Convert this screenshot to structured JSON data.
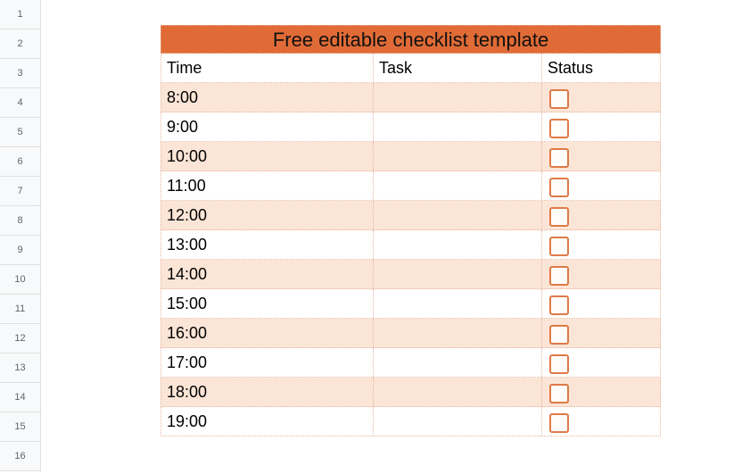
{
  "rowHeaders": [
    "1",
    "2",
    "3",
    "4",
    "5",
    "6",
    "7",
    "8",
    "9",
    "10",
    "11",
    "12",
    "13",
    "14",
    "15",
    "16"
  ],
  "title": "Free editable checklist template",
  "columns": {
    "time": "Time",
    "task": "Task",
    "status": "Status"
  },
  "entries": [
    {
      "time": "8:00",
      "task": "",
      "checked": false
    },
    {
      "time": "9:00",
      "task": "",
      "checked": false
    },
    {
      "time": "10:00",
      "task": "",
      "checked": false
    },
    {
      "time": "11:00",
      "task": "",
      "checked": false
    },
    {
      "time": "12:00",
      "task": "",
      "checked": false
    },
    {
      "time": "13:00",
      "task": "",
      "checked": false
    },
    {
      "time": "14:00",
      "task": "",
      "checked": false
    },
    {
      "time": "15:00",
      "task": "",
      "checked": false
    },
    {
      "time": "16:00",
      "task": "",
      "checked": false
    },
    {
      "time": "17:00",
      "task": "",
      "checked": false
    },
    {
      "time": "18:00",
      "task": "",
      "checked": false
    },
    {
      "time": "19:00",
      "task": "",
      "checked": false
    }
  ]
}
